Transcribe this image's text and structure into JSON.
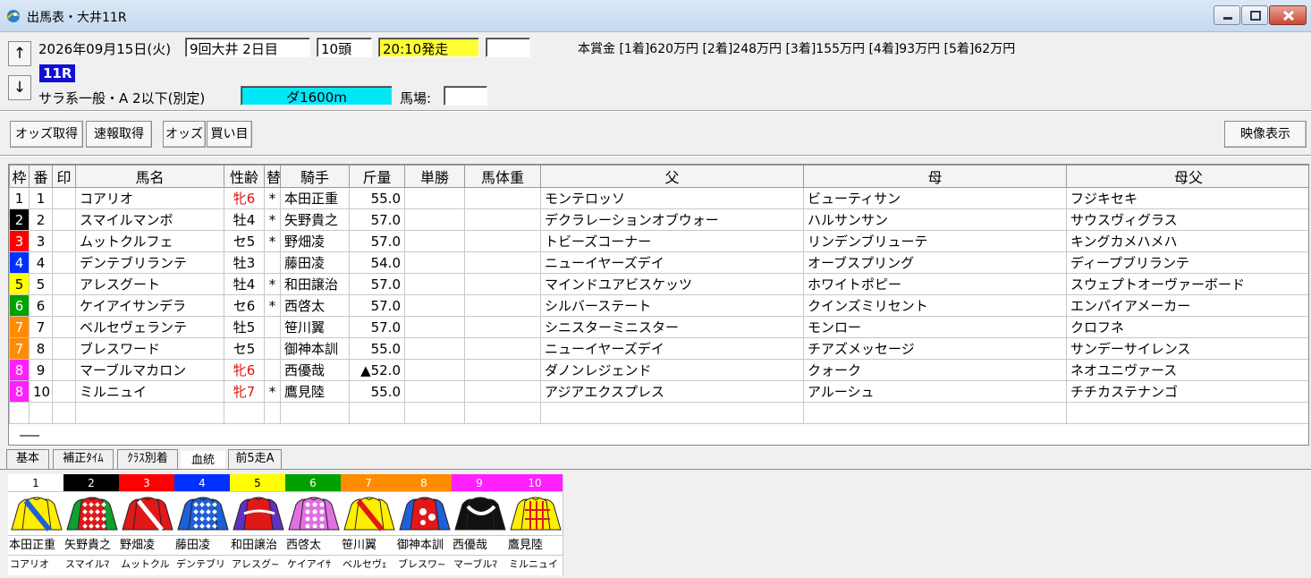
{
  "window": {
    "title": "出馬表・大井11R"
  },
  "race": {
    "date": "2026年09月15日(火)",
    "meeting": "9回大井 2日目",
    "runners": "10頭",
    "post_time": "20:10発走",
    "extra": "",
    "prize": "本賞金 [1着]620万円 [2着]248万円 [3着]155万円 [4着]93万円 [5着]62万円",
    "race_number": "11R",
    "class": "サラ系一般・A 2以下(別定)",
    "course": "ダ1600m",
    "track_label": "馬場:",
    "track_value": ""
  },
  "nav": {
    "up": "↑",
    "down": "↓"
  },
  "toolbar": {
    "odds_fetch": "オッズ取得",
    "quick_fetch": "速報取得",
    "odds": "オッズ",
    "bets": "買い目",
    "video": "映像表示"
  },
  "table": {
    "headers": [
      "枠",
      "番",
      "印",
      "馬名",
      "性齢",
      "替",
      "騎手",
      "斤量",
      "単勝",
      "馬体重",
      "父",
      "母",
      "母父"
    ],
    "rows": [
      {
        "waku": "1",
        "no": "1",
        "mark": "",
        "name": "コアリオ",
        "sexage": "牝6",
        "swap": "*",
        "jockey": "本田正重",
        "weight": "55.0",
        "win": "",
        "body": "",
        "sire": "モンテロッソ",
        "dam": "ビューティサン",
        "damsire": "フジキセキ"
      },
      {
        "waku": "2",
        "no": "2",
        "mark": "",
        "name": "スマイルマンボ",
        "sexage": "牡4",
        "swap": "*",
        "jockey": "矢野貴之",
        "weight": "57.0",
        "win": "",
        "body": "",
        "sire": "デクラレーションオブウォー",
        "dam": "ハルサンサン",
        "damsire": "サウスヴィグラス"
      },
      {
        "waku": "3",
        "no": "3",
        "mark": "",
        "name": "ムットクルフェ",
        "sexage": "セ5",
        "swap": "*",
        "jockey": "野畑凌",
        "weight": "57.0",
        "win": "",
        "body": "",
        "sire": "トビーズコーナー",
        "dam": "リンデンブリューテ",
        "damsire": "キングカメハメハ"
      },
      {
        "waku": "4",
        "no": "4",
        "mark": "",
        "name": "デンテブリランテ",
        "sexage": "牡3",
        "swap": "",
        "jockey": "藤田凌",
        "weight": "54.0",
        "win": "",
        "body": "",
        "sire": "ニューイヤーズデイ",
        "dam": "オーブスプリング",
        "damsire": "ディープブリランテ"
      },
      {
        "waku": "5",
        "no": "5",
        "mark": "",
        "name": "アレスグート",
        "sexage": "牡4",
        "swap": "*",
        "jockey": "和田譲治",
        "weight": "57.0",
        "win": "",
        "body": "",
        "sire": "マインドユアビスケッツ",
        "dam": "ホワイトポピー",
        "damsire": "スウェプトオーヴァーボード"
      },
      {
        "waku": "6",
        "no": "6",
        "mark": "",
        "name": "ケイアイサンデラ",
        "sexage": "セ6",
        "swap": "*",
        "jockey": "西啓太",
        "weight": "57.0",
        "win": "",
        "body": "",
        "sire": "シルバーステート",
        "dam": "クインズミリセント",
        "damsire": "エンパイアメーカー"
      },
      {
        "waku": "7",
        "no": "7",
        "mark": "",
        "name": "ベルセヴェランテ",
        "sexage": "牡5",
        "swap": "",
        "jockey": "笹川翼",
        "weight": "57.0",
        "win": "",
        "body": "",
        "sire": "シニスターミニスター",
        "dam": "モンロー",
        "damsire": "クロフネ"
      },
      {
        "waku": "7",
        "no": "8",
        "mark": "",
        "name": "ブレスワード",
        "sexage": "セ5",
        "swap": "",
        "jockey": "御神本訓",
        "weight": "55.0",
        "win": "",
        "body": "",
        "sire": "ニューイヤーズデイ",
        "dam": "チアズメッセージ",
        "damsire": "サンデーサイレンス"
      },
      {
        "waku": "8",
        "no": "9",
        "mark": "",
        "name": "マーブルマカロン",
        "sexage": "牝6",
        "swap": "",
        "jockey": "西優哉",
        "weight": "▲52.0",
        "win": "",
        "body": "",
        "sire": "ダノンレジェンド",
        "dam": "クォーク",
        "damsire": "ネオユニヴァース"
      },
      {
        "waku": "8",
        "no": "10",
        "mark": "",
        "name": "ミルニュイ",
        "sexage": "牝7",
        "swap": "*",
        "jockey": "鷹見陸",
        "weight": "55.0",
        "win": "",
        "body": "",
        "sire": "アジアエクスプレス",
        "dam": "アルーシュ",
        "damsire": "チチカステナンゴ"
      }
    ]
  },
  "waku_colors": {
    "1": {
      "bg": "#ffffff",
      "fg": "#000000"
    },
    "2": {
      "bg": "#000000",
      "fg": "#ffffff"
    },
    "3": {
      "bg": "#ff0000",
      "fg": "#ffffff"
    },
    "4": {
      "bg": "#0030ff",
      "fg": "#ffffff"
    },
    "5": {
      "bg": "#ffff00",
      "fg": "#000000"
    },
    "6": {
      "bg": "#00a000",
      "fg": "#ffffff"
    },
    "7": {
      "bg": "#ff8c00",
      "fg": "#ffffff"
    },
    "8": {
      "bg": "#ff20ff",
      "fg": "#ffffff"
    }
  },
  "tabs": [
    "基本",
    "補正ﾀｲﾑ",
    "ｸﾗｽ別着",
    "血統",
    "前5走A"
  ],
  "active_tab": 3,
  "silks": [
    {
      "no": "1",
      "jockey": "本田正重",
      "horse": "コアリオ",
      "body": "#ffee00",
      "accent": "#1e5fd8",
      "pattern": "sash"
    },
    {
      "no": "2",
      "jockey": "矢野貴之",
      "horse": "スマイルﾏ",
      "body": "#e01818",
      "accent": "#ffffff",
      "pattern": "diamonds",
      "sleeve": "#10a030"
    },
    {
      "no": "3",
      "jockey": "野畑凌",
      "horse": "ムットクル",
      "body": "#e01818",
      "accent": "#ffffff",
      "pattern": "sash2"
    },
    {
      "no": "4",
      "jockey": "藤田凌",
      "horse": "デンテブリ",
      "body": "#1f5fd8",
      "accent": "#ffffff",
      "pattern": "diamonds"
    },
    {
      "no": "5",
      "jockey": "和田譲治",
      "horse": "アレスグ~",
      "body": "#e01818",
      "accent": "#ffffff",
      "pattern": "band",
      "sleeve": "#6030c0"
    },
    {
      "no": "6",
      "jockey": "西啓太",
      "horse": "ケイアイｻ",
      "body": "#e070e0",
      "accent": "#ffffff",
      "pattern": "dots"
    },
    {
      "no": "7",
      "jockey": "笹川翼",
      "horse": "ベルセヴｪ",
      "body": "#ffee00",
      "accent": "#e01818",
      "pattern": "sash"
    },
    {
      "no": "8",
      "jockey": "御神本訓",
      "horse": "ブレスワ~",
      "body": "#e01818",
      "accent": "#ffffff",
      "pattern": "stars",
      "sleeve": "#1f5fd8"
    },
    {
      "no": "9",
      "jockey": "西優哉",
      "horse": "マーブルﾏ",
      "body": "#111111",
      "accent": "#ffffff",
      "pattern": "yoke"
    },
    {
      "no": "10",
      "jockey": "鷹見陸",
      "horse": "ミルニュイ",
      "body": "#ffee00",
      "accent": "#e01818",
      "pattern": "grid"
    }
  ]
}
